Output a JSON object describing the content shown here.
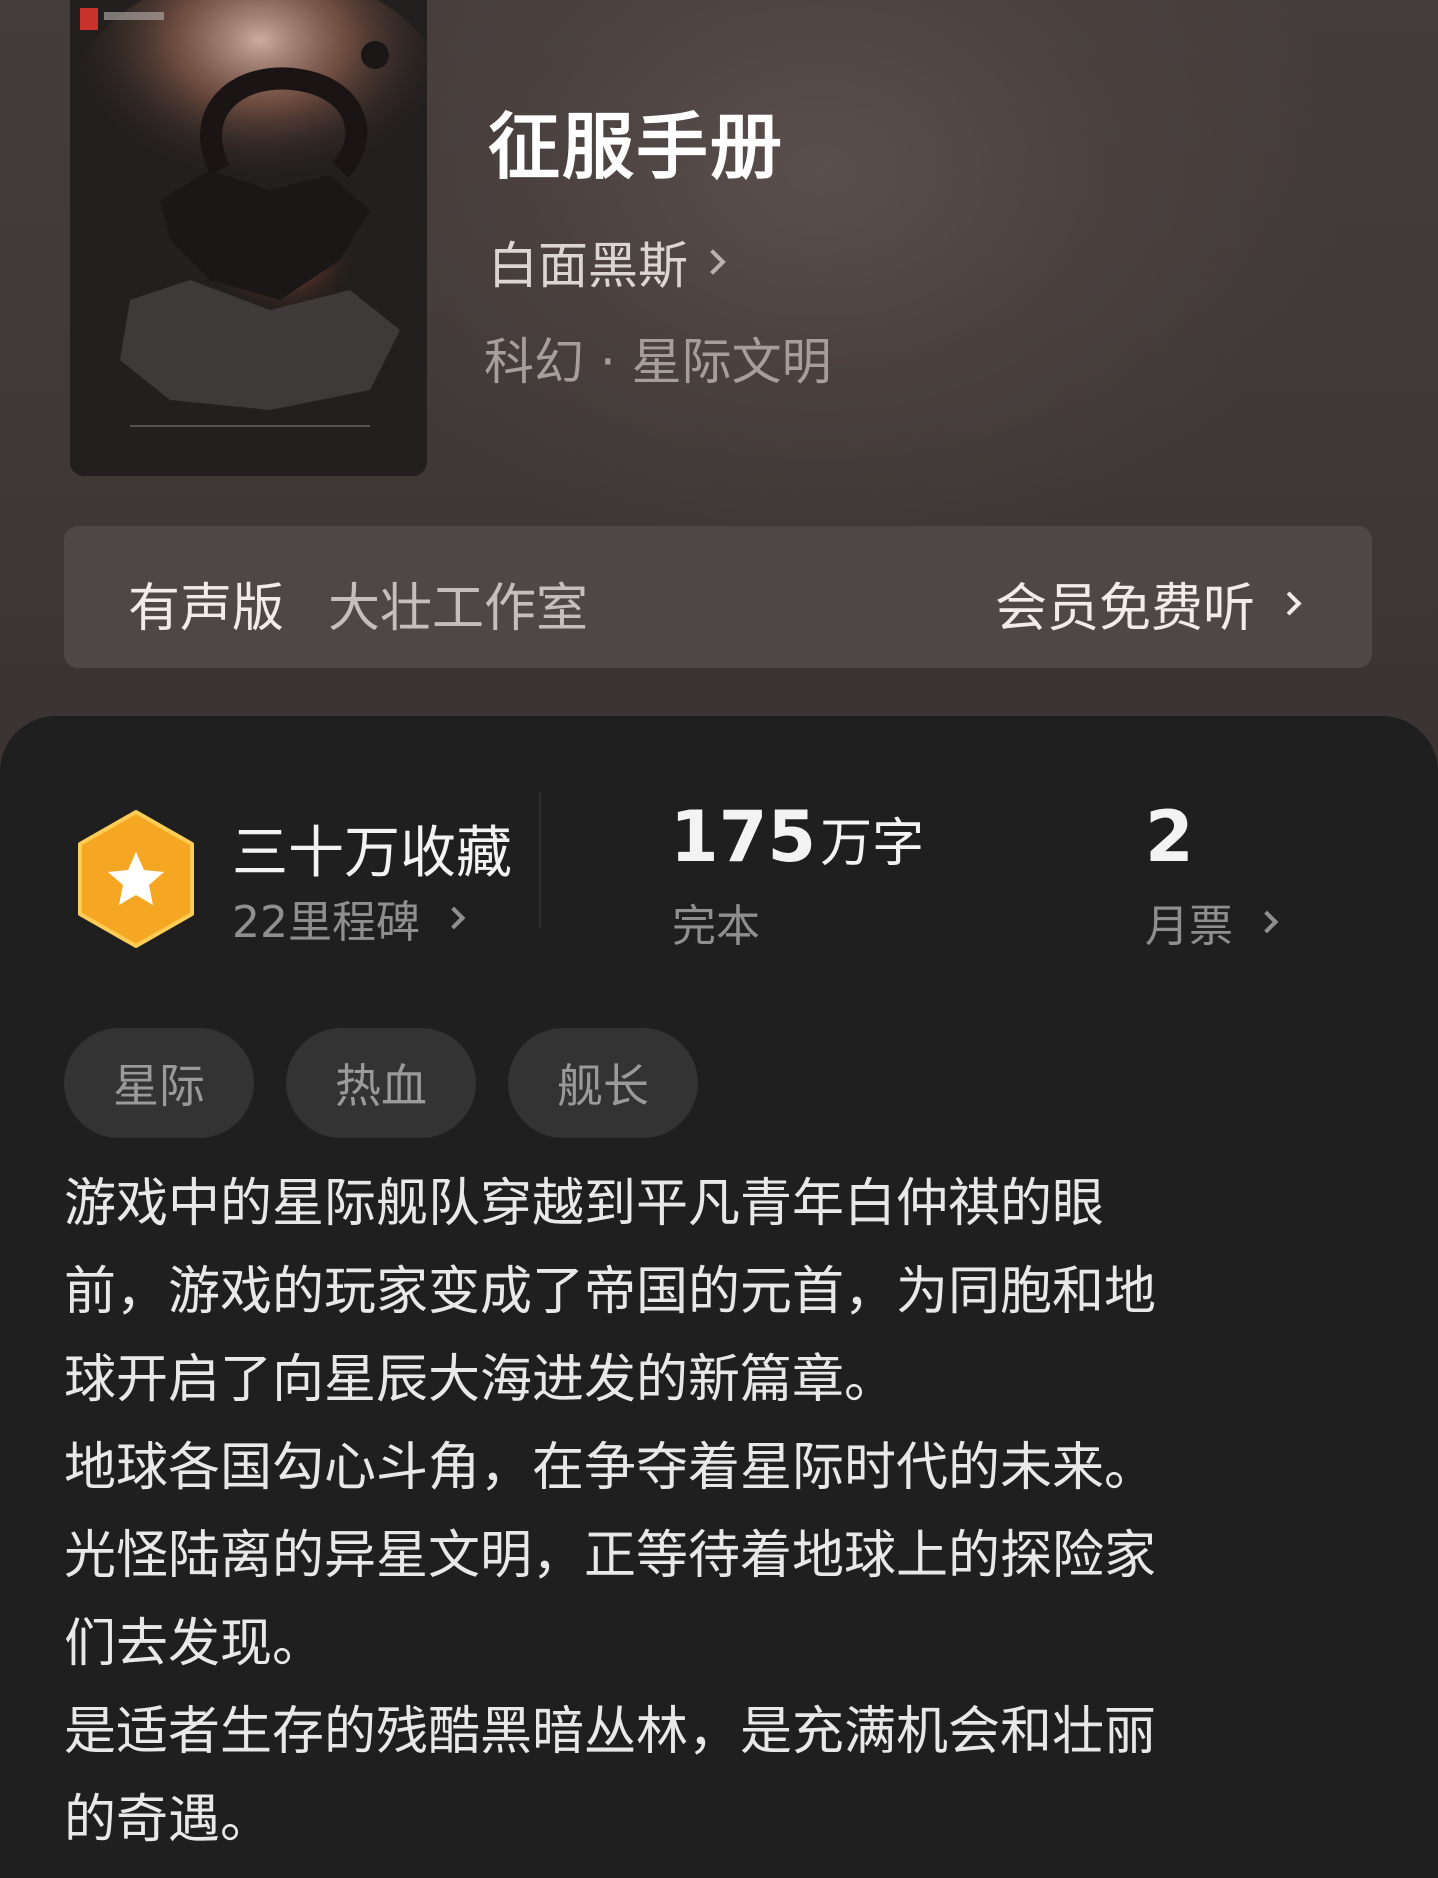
{
  "book": {
    "title": "征服手册",
    "author": "白面黑斯",
    "genre": "科幻 · 星际文明"
  },
  "audio": {
    "label": "有声版",
    "studio": "大壮工作室",
    "action": "会员免费听"
  },
  "stats": {
    "collect": "三十万收藏",
    "milestone": "22里程碑",
    "words_num": "175",
    "words_unit": "万字",
    "status": "完本",
    "votes_num": "2",
    "votes_label": "月票"
  },
  "tags": [
    "星际",
    "热血",
    "舰长"
  ],
  "description": [
    "游戏中的星际舰队穿越到平凡青年白仲祺的眼",
    "前，游戏的玩家变成了帝国的元首，为同胞和地",
    "球开启了向星辰大海进发的新篇章。",
    "地球各国勾心斗角，在争夺着星际时代的未来。",
    "光怪陆离的异星文明，正等待着地球上的探险家",
    "们去发现。",
    "是适者生存的残酷黑暗丛林，是充满机会和壮丽",
    "的奇遇。"
  ],
  "colors": {
    "badge": "#f5a623",
    "panel": "#1f1f1f",
    "tag_bg": "#333333"
  }
}
